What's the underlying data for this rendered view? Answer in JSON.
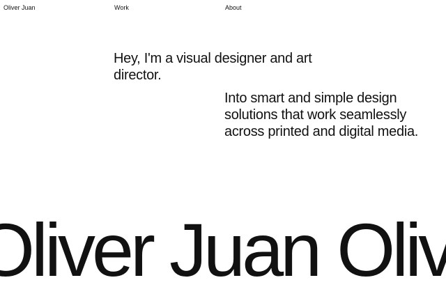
{
  "nav": {
    "home": "Oliver Juan",
    "work": "Work",
    "about": "About"
  },
  "intro": {
    "headline": "Hey, I'm a visual designer and art director.",
    "description": "Into smart and simple design solutions that work seamlessly across printed and digital media."
  },
  "marquee": {
    "items": [
      "Oliver Juan",
      "Oliver Juan"
    ]
  },
  "colors": {
    "background": "#ffffff",
    "text": "#111111"
  }
}
